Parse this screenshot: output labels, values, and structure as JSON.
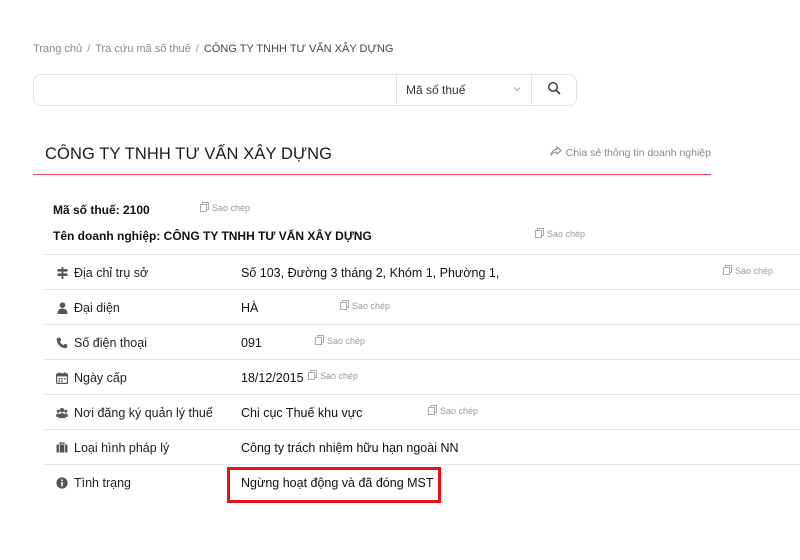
{
  "breadcrumb": {
    "home": "Trang chủ",
    "sep": "/",
    "lookup": "Tra cứu mã số thuế",
    "current": "CÔNG TY TNHH TƯ VẤN XÂY DỰNG"
  },
  "search": {
    "value": "",
    "placeholder": "",
    "selected_option": "Mã số thuế",
    "icon": "search-icon"
  },
  "company": {
    "title": "CÔNG TY TNHH TƯ VẤN XÂY DỰNG",
    "share_label": "Chia sẻ thông tin doanh nghiệp"
  },
  "copy_label": "Sao chép",
  "top": {
    "tax_code": "Mã số thuế: 2100",
    "company_name": "Tên doanh nghiệp: CÔNG TY TNHH TƯ VẤN XÂY DỰNG"
  },
  "rows": [
    {
      "icon": "signpost-icon",
      "label": "Địa chỉ trụ sở",
      "value": "Số 103, Đường 3 tháng 2, Khóm 1, Phường 1,"
    },
    {
      "icon": "user-icon",
      "label": "Đại diện",
      "value": "HÀ"
    },
    {
      "icon": "phone-icon",
      "label": "Số điện thoại",
      "value": "091"
    },
    {
      "icon": "calendar-icon",
      "label": "Ngày cấp",
      "value": "18/12/2015"
    },
    {
      "icon": "users-icon",
      "label": "Nơi đăng ký quản lý thuế",
      "value": "Chi cục Thuế khu vực"
    },
    {
      "icon": "briefcase-icon",
      "label": "Loại hình pháp lý",
      "value": "Công ty trách nhiệm hữu hạn ngoài NN"
    },
    {
      "icon": "info-icon",
      "label": "Tình trạng",
      "value": "Ngừng hoạt động và đã đóng MST"
    }
  ],
  "colors": {
    "accent_line": "#e64563",
    "highlight_border": "#e8101a"
  }
}
